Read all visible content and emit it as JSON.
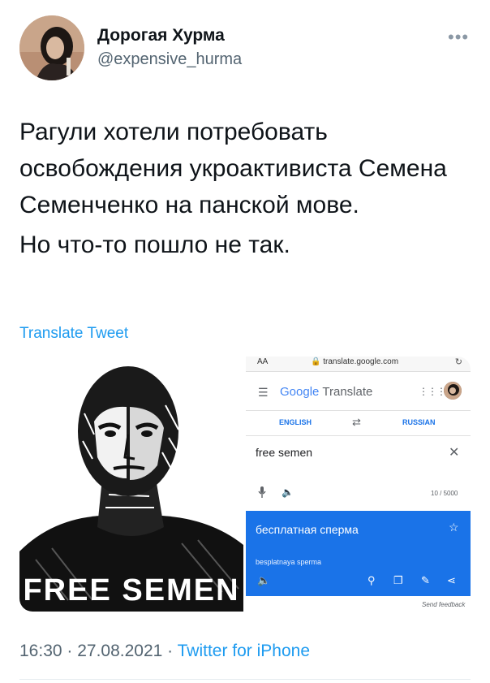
{
  "user": {
    "display_name": "Дорогая Хурма",
    "handle": "@expensive_hurma"
  },
  "tweet": {
    "paragraphs": [
      "Рагули хотели потребовать освобождения укроактивиста Семена Семенченко на панской мове.",
      "Но что-то пошло не так."
    ],
    "translate_label": "Translate Tweet"
  },
  "media": {
    "artwork_text": "FREE SEMEN",
    "screenshot": {
      "browser": {
        "aa_label": "AA",
        "url": "translate.google.com"
      },
      "app_title_google": "Google",
      "app_title_translate": "Translate",
      "source_lang": "ENGLISH",
      "target_lang": "RUSSIAN",
      "input_text": "free semen",
      "char_count": "10 / 5000",
      "translation": "бесплатная сперма",
      "transliteration": "besplatnaya sperma",
      "send_feedback": "Send feedback"
    }
  },
  "footer": {
    "timestamp": "16:30 · 27.08.2021 · ",
    "source": "Twitter for iPhone"
  },
  "colors": {
    "link": "#1d9bf0",
    "text": "#0f1419",
    "muted": "#536471",
    "translate_blue": "#1a73e8"
  }
}
